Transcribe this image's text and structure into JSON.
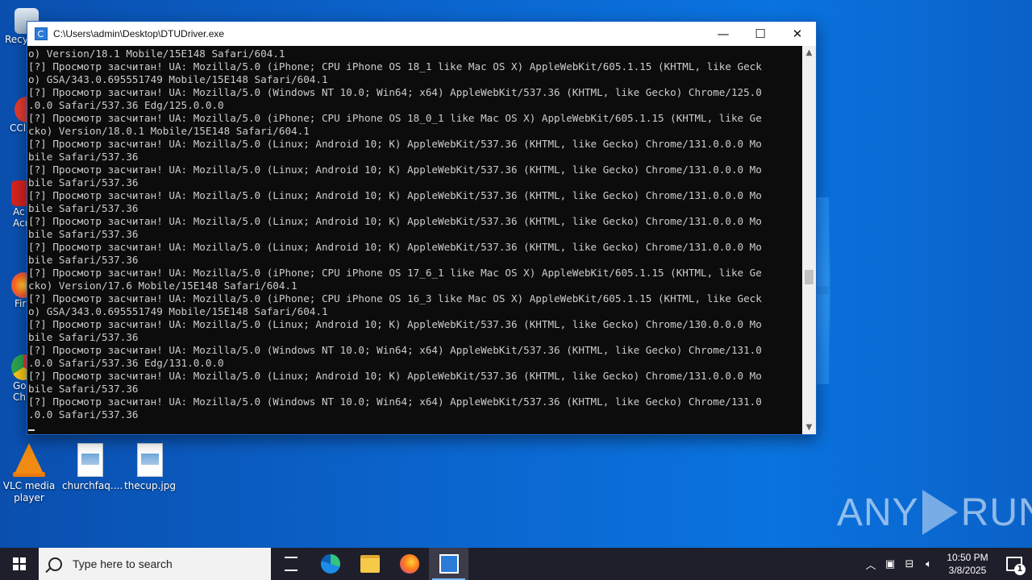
{
  "window": {
    "title": "C:\\Users\\admin\\Desktop\\DTUDriver.exe",
    "minimize_glyph": "—",
    "maximize_glyph": "☐",
    "close_glyph": "✕"
  },
  "console": {
    "lines": [
      "o) Version/18.1 Mobile/15E148 Safari/604.1",
      "[?] Просмотр засчитан! UA: Mozilla/5.0 (iPhone; CPU iPhone OS 18_1 like Mac OS X) AppleWebKit/605.1.15 (KHTML, like Geck",
      "o) GSA/343.0.695551749 Mobile/15E148 Safari/604.1",
      "[?] Просмотр засчитан! UA: Mozilla/5.0 (Windows NT 10.0; Win64; x64) AppleWebKit/537.36 (KHTML, like Gecko) Chrome/125.0",
      ".0.0 Safari/537.36 Edg/125.0.0.0",
      "[?] Просмотр засчитан! UA: Mozilla/5.0 (iPhone; CPU iPhone OS 18_0_1 like Mac OS X) AppleWebKit/605.1.15 (KHTML, like Ge",
      "cko) Version/18.0.1 Mobile/15E148 Safari/604.1",
      "[?] Просмотр засчитан! UA: Mozilla/5.0 (Linux; Android 10; K) AppleWebKit/537.36 (KHTML, like Gecko) Chrome/131.0.0.0 Mo",
      "bile Safari/537.36",
      "[?] Просмотр засчитан! UA: Mozilla/5.0 (Linux; Android 10; K) AppleWebKit/537.36 (KHTML, like Gecko) Chrome/131.0.0.0 Mo",
      "bile Safari/537.36",
      "[?] Просмотр засчитан! UA: Mozilla/5.0 (Linux; Android 10; K) AppleWebKit/537.36 (KHTML, like Gecko) Chrome/131.0.0.0 Mo",
      "bile Safari/537.36",
      "[?] Просмотр засчитан! UA: Mozilla/5.0 (Linux; Android 10; K) AppleWebKit/537.36 (KHTML, like Gecko) Chrome/131.0.0.0 Mo",
      "bile Safari/537.36",
      "[?] Просмотр засчитан! UA: Mozilla/5.0 (Linux; Android 10; K) AppleWebKit/537.36 (KHTML, like Gecko) Chrome/131.0.0.0 Mo",
      "bile Safari/537.36",
      "[?] Просмотр засчитан! UA: Mozilla/5.0 (iPhone; CPU iPhone OS 17_6_1 like Mac OS X) AppleWebKit/605.1.15 (KHTML, like Ge",
      "cko) Version/17.6 Mobile/15E148 Safari/604.1",
      "[?] Просмотр засчитан! UA: Mozilla/5.0 (iPhone; CPU iPhone OS 16_3 like Mac OS X) AppleWebKit/605.1.15 (KHTML, like Geck",
      "o) GSA/343.0.695551749 Mobile/15E148 Safari/604.1",
      "[?] Просмотр засчитан! UA: Mozilla/5.0 (Linux; Android 10; K) AppleWebKit/537.36 (KHTML, like Gecko) Chrome/130.0.0.0 Mo",
      "bile Safari/537.36",
      "[?] Просмотр засчитан! UA: Mozilla/5.0 (Windows NT 10.0; Win64; x64) AppleWebKit/537.36 (KHTML, like Gecko) Chrome/131.0",
      ".0.0 Safari/537.36 Edg/131.0.0.0",
      "[?] Просмотр засчитан! UA: Mozilla/5.0 (Linux; Android 10; K) AppleWebKit/537.36 (KHTML, like Gecko) Chrome/131.0.0.0 Mo",
      "bile Safari/537.36",
      "[?] Просмотр засчитан! UA: Mozilla/5.0 (Windows NT 10.0; Win64; x64) AppleWebKit/537.36 (KHTML, like Gecko) Chrome/131.0",
      ".0.0 Safari/537.36"
    ]
  },
  "desktop": {
    "icons_left_partial": [
      "Recy",
      "CCl",
      "Ac Acr",
      "Fir",
      "Go Chr"
    ],
    "icons": [
      {
        "label": "VLC media player",
        "icon": "vlc-icon"
      },
      {
        "label": "churchfaq....",
        "icon": "image-file-icon"
      },
      {
        "label": "thecup.jpg",
        "icon": "image-file-icon"
      }
    ]
  },
  "watermark": {
    "left": "ANY",
    "right": "RUN"
  },
  "taskbar": {
    "search_placeholder": "Type here to search",
    "time": "10:50 PM",
    "date": "3/8/2025",
    "notification_count": "1"
  }
}
